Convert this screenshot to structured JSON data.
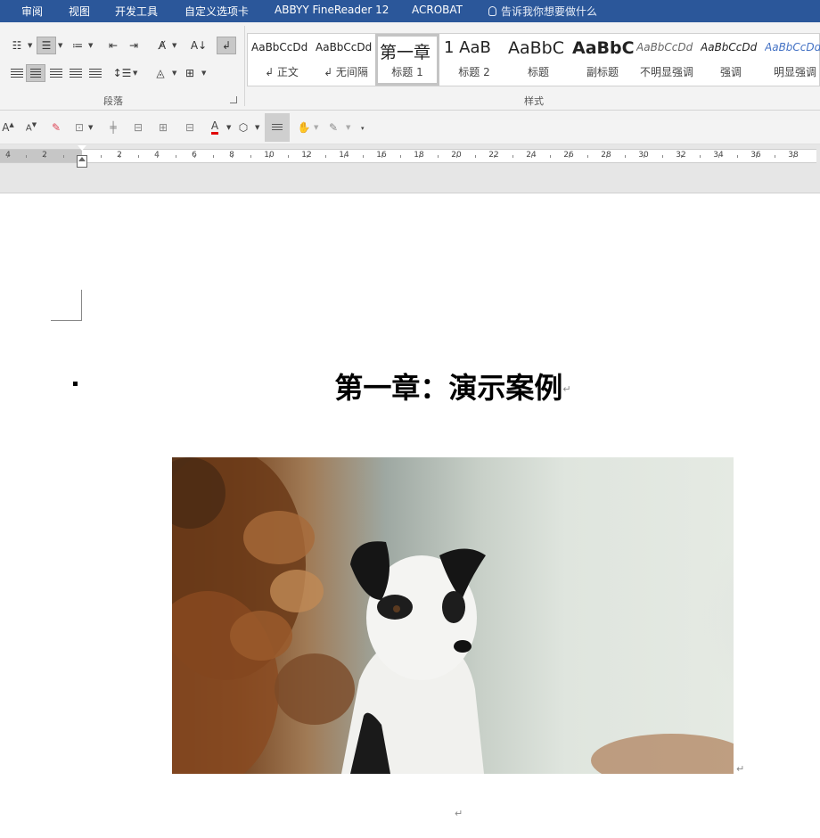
{
  "ribbon_tabs": [
    "审阅",
    "视图",
    "开发工具",
    "自定义选项卡",
    "ABBYY FineReader 12",
    "ACROBAT"
  ],
  "tell_me": "告诉我你想要做什么",
  "groups": {
    "paragraph": "段落",
    "styles": "样式"
  },
  "styles": [
    {
      "sample": "AaBbCcDd",
      "name": "↲ 正文"
    },
    {
      "sample": "AaBbCcDd",
      "name": "↲ 无间隔"
    },
    {
      "sample": "第一章",
      "name": "标题 1"
    },
    {
      "sample": "1 AaB",
      "name": "标题 2"
    },
    {
      "sample": "AaBbC",
      "name": "标题"
    },
    {
      "sample": "AaBbC",
      "name": "副标题"
    },
    {
      "sample": "AaBbCcDd",
      "name": "不明显强调"
    },
    {
      "sample": "AaBbCcDd",
      "name": "强调"
    },
    {
      "sample": "AaBbCcDd",
      "name": "明显强调"
    }
  ],
  "ruler_numbers": [
    "4",
    "2",
    "2",
    "4",
    "6",
    "8",
    "10",
    "12",
    "14",
    "16",
    "18",
    "20",
    "22",
    "24",
    "26",
    "28",
    "30",
    "32",
    "34",
    "36",
    "38"
  ],
  "document": {
    "heading": "第一章：演示案例",
    "paragraph_mark": "↵"
  },
  "colors": {
    "ribbon": "#2b579a",
    "font_color_bar": "#e00000"
  }
}
